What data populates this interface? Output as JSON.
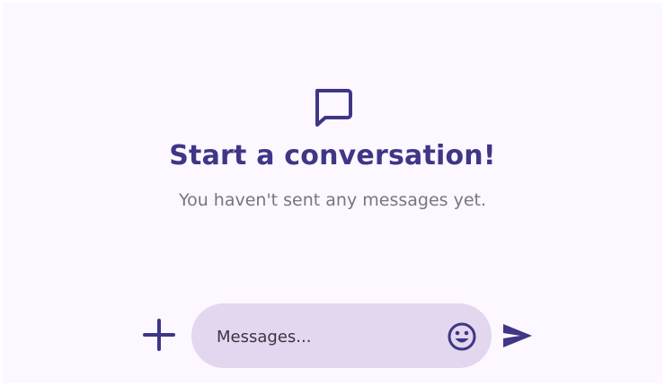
{
  "empty_state": {
    "icon": "chat-bubble-icon",
    "title": "Start a conversation!",
    "subtitle": "You haven't sent any messages yet."
  },
  "composer": {
    "attach_icon": "plus-icon",
    "input_value": "",
    "input_placeholder": "Messages...",
    "emoji_icon": "emoji-icon",
    "send_icon": "send-icon"
  },
  "colors": {
    "background": "#fdf7ff",
    "accent": "#3f3686",
    "input_fill": "#e2d7ee",
    "subtitle_text": "#7a7480"
  }
}
